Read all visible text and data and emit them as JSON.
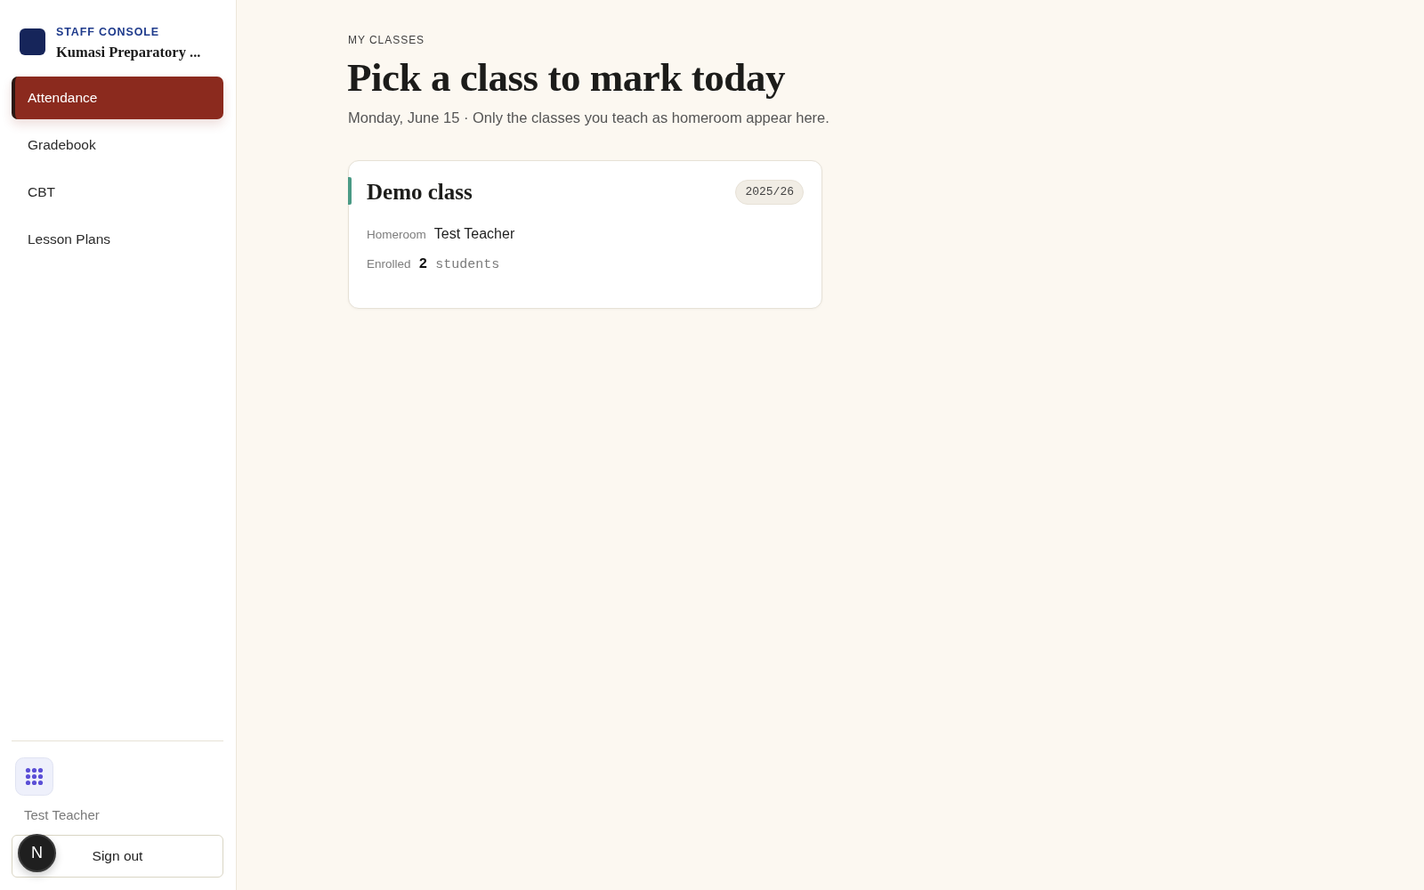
{
  "sidebar": {
    "brand": {
      "eyebrow": "STAFF CONSOLE",
      "name": "Kumasi Preparatory ..."
    },
    "nav": [
      {
        "label": "Attendance",
        "selected": true
      },
      {
        "label": "Gradebook",
        "selected": false
      },
      {
        "label": "CBT",
        "selected": false
      },
      {
        "label": "Lesson Plans",
        "selected": false
      }
    ],
    "user_name": "Test Teacher",
    "sign_out": "Sign out"
  },
  "dev_badge": {
    "label": "N"
  },
  "main": {
    "eyebrow": "MY CLASSES",
    "title": "Pick a class to mark today",
    "subtitle": "Monday, June 15 · Only the classes you teach as homeroom appear here.",
    "classes": [
      {
        "name": "Demo class",
        "year": "2025/26",
        "color": "#4a9a85",
        "fields": [
          {
            "kind": "text",
            "label": "Homeroom",
            "value": "Test Teacher"
          },
          {
            "kind": "count",
            "label": "Enrolled",
            "count": "2",
            "unit": "students"
          }
        ]
      }
    ]
  }
}
